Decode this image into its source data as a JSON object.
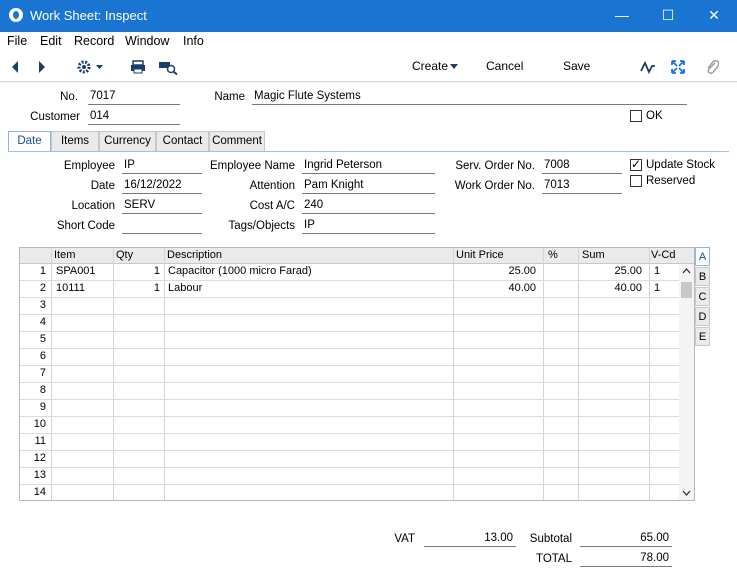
{
  "window": {
    "title": "Work Sheet: Inspect",
    "minimize": "—",
    "maximize": "☐",
    "close": "✕"
  },
  "menu": [
    "File",
    "Edit",
    "Record",
    "Window",
    "Info"
  ],
  "toolbar": {
    "create_label": "Create",
    "cancel_label": "Cancel",
    "save_label": "Save"
  },
  "header": {
    "no_label": "No.",
    "no_value": "7017",
    "name_label": "Name",
    "name_value": "Magic Flute Systems",
    "customer_label": "Customer",
    "customer_value": "014",
    "ok_label": "OK",
    "ok_checked": false
  },
  "tabs": [
    "Date",
    "Items",
    "Currency",
    "Contact",
    "Comment"
  ],
  "date_tab": {
    "employee_label": "Employee",
    "employee_value": "IP",
    "date_label": "Date",
    "date_value": "16/12/2022",
    "location_label": "Location",
    "location_value": "SERV",
    "short_code_label": "Short Code",
    "short_code_value": "",
    "employee_name_label": "Employee Name",
    "employee_name_value": "Ingrid Peterson",
    "attention_label": "Attention",
    "attention_value": "Pam Knight",
    "cost_ac_label": "Cost A/C",
    "cost_ac_value": "240",
    "tags_label": "Tags/Objects",
    "tags_value": "IP",
    "serv_order_label": "Serv. Order No.",
    "serv_order_value": "7008",
    "work_order_label": "Work Order No.",
    "work_order_value": "7013",
    "update_stock_label": "Update Stock",
    "update_stock_checked": true,
    "reserved_label": "Reserved",
    "reserved_checked": false
  },
  "grid": {
    "columns": [
      "Item",
      "Qty",
      "Description",
      "Unit Price",
      "%",
      "Sum",
      "V-Cd"
    ],
    "rows": [
      {
        "n": "1",
        "item": "SPA001",
        "qty": "1",
        "desc": "Capacitor (1000 micro Farad)",
        "price": "25.00",
        "pct": "",
        "sum": "25.00",
        "vcd": "1"
      },
      {
        "n": "2",
        "item": "10111",
        "qty": "1",
        "desc": "Labour",
        "price": "40.00",
        "pct": "",
        "sum": "40.00",
        "vcd": "1"
      },
      {
        "n": "3"
      },
      {
        "n": "4"
      },
      {
        "n": "5"
      },
      {
        "n": "6"
      },
      {
        "n": "7"
      },
      {
        "n": "8"
      },
      {
        "n": "9"
      },
      {
        "n": "10"
      },
      {
        "n": "11"
      },
      {
        "n": "12"
      },
      {
        "n": "13"
      },
      {
        "n": "14"
      }
    ],
    "side_tabs": [
      "A",
      "B",
      "C",
      "D",
      "E"
    ]
  },
  "footer": {
    "vat_label": "VAT",
    "vat_value": "13.00",
    "subtotal_label": "Subtotal",
    "subtotal_value": "65.00",
    "total_label": "TOTAL",
    "total_value": "78.00"
  }
}
